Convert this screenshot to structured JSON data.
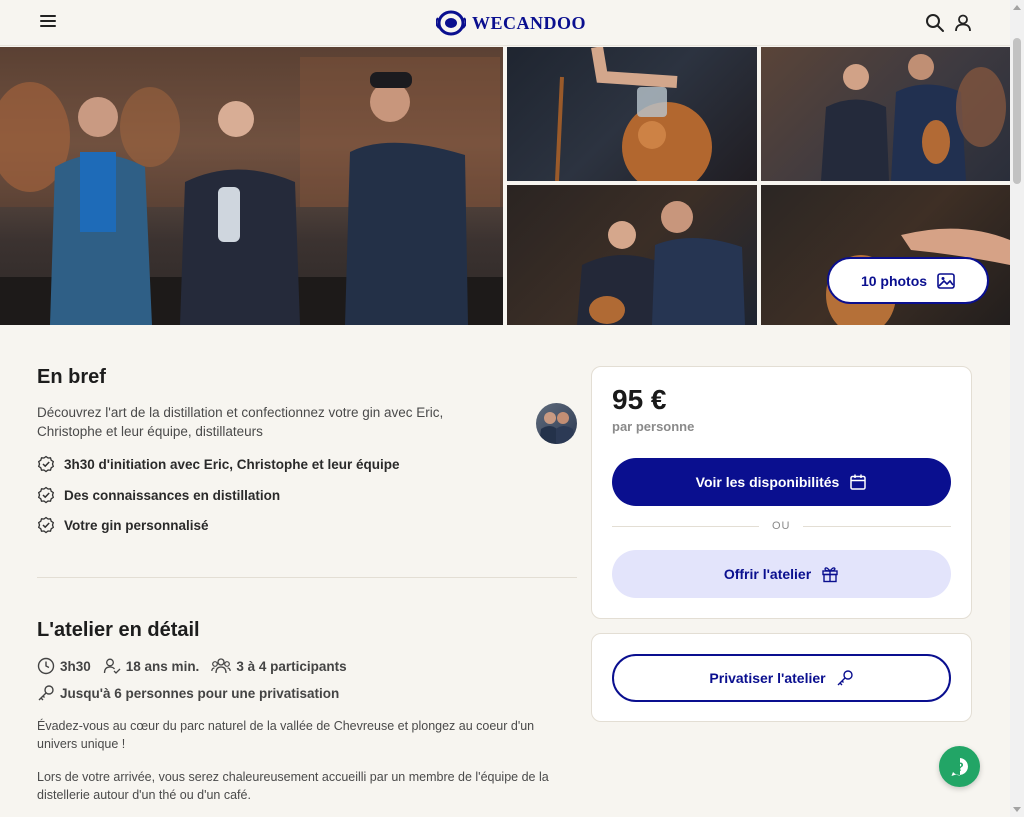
{
  "header": {
    "logo_text": "WECANDOO",
    "menu_icon": "hamburger-menu-icon",
    "search_icon": "search-icon",
    "user_icon": "user-icon"
  },
  "gallery": {
    "photos_button_label": "10 photos",
    "photos_icon": "image-icon"
  },
  "brief": {
    "title": "En bref",
    "intro": "Découvrez l'art de la distillation et confectionnez votre gin avec Eric, Christophe et leur équipe, distillateurs",
    "bullets": [
      "3h30 d'initiation avec Eric, Christophe et leur équipe",
      "Des connaissances en distillation",
      "Votre gin personnalisé"
    ]
  },
  "detail": {
    "title": "L'atelier en détail",
    "duration": "3h30",
    "age": "18 ans min.",
    "participants": "3 à 4 participants",
    "privatisation": "Jusqu'à 6 personnes pour une privatisation",
    "paragraphs": [
      "Évadez-vous au cœur du parc naturel de la vallée de Chevreuse et plongez au coeur d'un univers unique !",
      "Lors de votre arrivée, vous serez chaleureusement accueilli par un membre de l'équipe de la distellerie autour d'un thé ou d'un café."
    ]
  },
  "booking": {
    "price": "95 €",
    "per": "par personne",
    "availability_label": "Voir les disponibilités",
    "or_label": "OU",
    "gift_label": "Offrir l'atelier",
    "private_label": "Privatiser l'atelier"
  },
  "colors": {
    "brand": "#0a0f8f",
    "brand_light": "#e3e4fb",
    "help": "#22a566",
    "background": "#f7f5f0"
  }
}
